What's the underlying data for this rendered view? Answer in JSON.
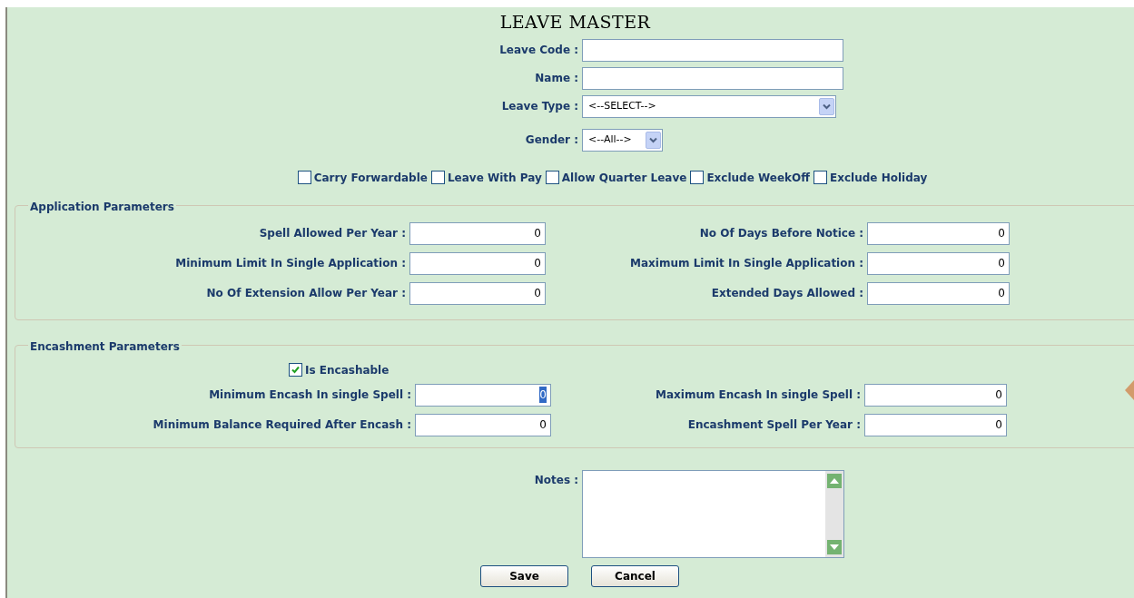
{
  "title": "LEAVE MASTER",
  "fields": [
    {
      "kind": "text",
      "label": "Leave Code :"
    },
    {
      "kind": "text",
      "label": "Name :"
    },
    {
      "kind": "select",
      "label": "Leave Type :",
      "value": "<--SELECT-->"
    },
    {
      "kind": "small-select",
      "label": "Gender :",
      "value": "<--All-->"
    }
  ],
  "options": [
    {
      "label": "Carry Forwardable",
      "checked": false
    },
    {
      "label": "Leave With Pay",
      "checked": false
    },
    {
      "label": "Allow Quarter Leave",
      "checked": false
    },
    {
      "label": "Exclude WeekOff",
      "checked": false
    },
    {
      "label": "Exclude Holiday",
      "checked": false
    }
  ],
  "sections": [
    {
      "legend": "Application Parameters",
      "rows": [
        {
          "left": {
            "label": "Spell Allowed Per Year :",
            "value": "0",
            "highlighted": false
          },
          "right": {
            "label": "No Of Days Before Notice :",
            "value": "0",
            "highlighted": false
          }
        },
        {
          "left": {
            "label": "Minimum Limit In Single Application :",
            "value": "0",
            "highlighted": false
          },
          "right": {
            "label": "Maximum Limit In Single Application :",
            "value": "0",
            "highlighted": false
          }
        },
        {
          "left": {
            "label": "No Of Extension Allow Per Year :",
            "value": "0",
            "highlighted": false
          },
          "right": {
            "label": "Extended Days Allowed :",
            "value": "0",
            "highlighted": false
          }
        }
      ]
    },
    {
      "legend": "Encashment Parameters",
      "checkbox": {
        "label": "Is Encashable",
        "checked": true
      },
      "rows": [
        {
          "left": {
            "label": "Minimum Encash In single Spell :",
            "value": "0",
            "highlighted": true
          },
          "right": {
            "label": "Maximum Encash In single Spell :",
            "value": "0",
            "highlighted": false
          }
        },
        {
          "left": {
            "label": "Minimum Balance Required After Encash :",
            "value": "0",
            "highlighted": false
          },
          "right": {
            "label": "Encashment Spell Per Year :",
            "value": "0",
            "highlighted": false
          }
        }
      ]
    }
  ],
  "notes": {
    "label": "Notes :"
  },
  "buttons": [
    "Save",
    "Cancel"
  ]
}
